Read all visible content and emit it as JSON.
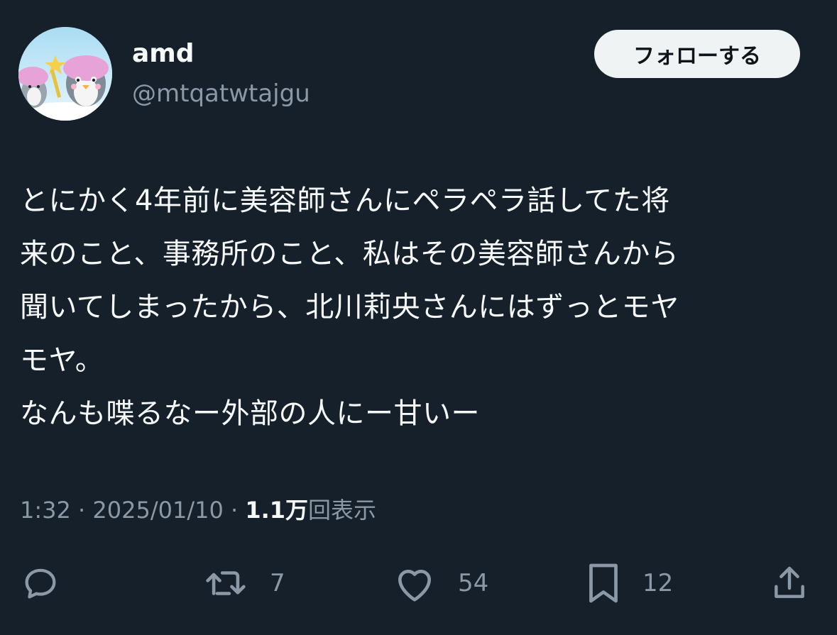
{
  "user": {
    "display_name": "amd",
    "handle": "@mtqatwtajgu"
  },
  "follow_button_label": "フォローする",
  "tweet_text": "とにかく4年前に美容師さんにペラペラ話してた将\n来のこと、事務所のこと、私はその美容師さんから\n聞いてしまったから、北川莉央さんにはずっとモヤ\nモヤ。\nなんも喋るなー外部の人にー甘いー",
  "meta": {
    "time": "1:32",
    "separator": " · ",
    "date": "2025/01/10",
    "views_count": "1.1万",
    "views_label": "回表示"
  },
  "actions": {
    "reply_count": "",
    "retweet_count": "7",
    "like_count": "54",
    "bookmark_count": "12"
  },
  "icons": {
    "reply": "reply-icon",
    "retweet": "retweet-icon",
    "like": "heart-icon",
    "bookmark": "bookmark-icon",
    "share": "share-icon"
  },
  "colors": {
    "background": "#15202b",
    "text": "#f7f9f9",
    "secondary_text": "#8b98a5",
    "follow_button_bg": "#eff3f4"
  }
}
